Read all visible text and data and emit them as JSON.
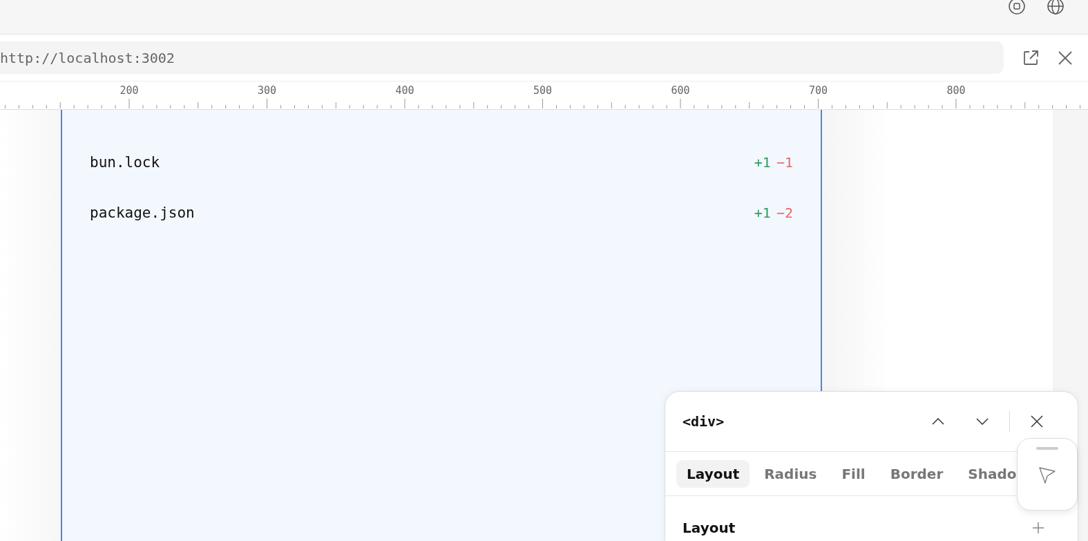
{
  "address_bar": {
    "url": "http://localhost:3002"
  },
  "ruler": {
    "labels": [
      "200",
      "300",
      "400",
      "500",
      "600",
      "700",
      "800"
    ]
  },
  "changes": [
    {
      "file": "bun.lock",
      "added": "+1",
      "removed": "−1"
    },
    {
      "file": "package.json",
      "added": "+1",
      "removed": "−2"
    }
  ],
  "inspector": {
    "element": "<div>",
    "tabs": [
      {
        "label": "Layout",
        "selected": true
      },
      {
        "label": "Radius",
        "selected": false
      },
      {
        "label": "Fill",
        "selected": false
      },
      {
        "label": "Border",
        "selected": false
      },
      {
        "label": "Shado",
        "selected": false
      }
    ],
    "section": "Layout"
  }
}
